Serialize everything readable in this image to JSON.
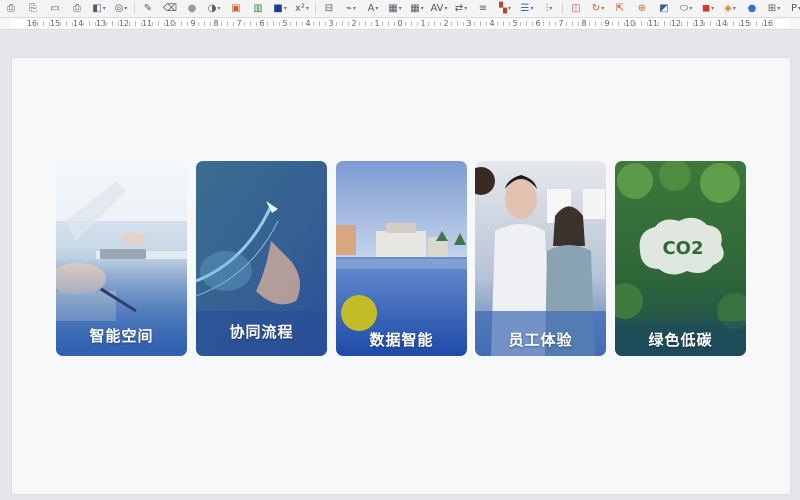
{
  "toolbar": {
    "icons": [
      "print-icon",
      "print-preview-icon",
      "page-setup-icon",
      "format-painter-icon",
      "text-color-icon",
      "clear-format-icon",
      "brush-icon",
      "eraser-icon",
      "circle-icon",
      "shape-icon",
      "image-icon",
      "chart-icon",
      "table-style-icon",
      "fill-color-icon",
      "superscript-icon",
      "textbox-icon",
      "link-icon",
      "font-icon",
      "border-icon",
      "table-icon",
      "spacing-icon",
      "text-direction-icon",
      "align-icon",
      "color-grid-icon",
      "indent-icon",
      "distribute-icon",
      "crop-icon",
      "rotate-icon",
      "arrange-icon",
      "group-icon",
      "shadow-icon",
      "outline-icon",
      "shape-fill-icon",
      "effects-icon",
      "record-icon",
      "export-icon",
      "picture-icon",
      "share-icon",
      "more-icon"
    ]
  },
  "ruler": {
    "labels": [
      "16",
      "15",
      "14",
      "13",
      "12",
      "11",
      "10",
      "9",
      "8",
      "7",
      "6",
      "5",
      "4",
      "3",
      "2",
      "1",
      "0",
      "1",
      "2",
      "3",
      "4",
      "5",
      "6",
      "7",
      "8",
      "9",
      "10",
      "11",
      "12",
      "13",
      "14",
      "15",
      "16"
    ]
  },
  "slide": {
    "cards": [
      {
        "label": "智能空间"
      },
      {
        "label": "协同流程"
      },
      {
        "label": "数据智能"
      },
      {
        "label": "员工体验"
      },
      {
        "label": "绿色低碳",
        "badge": "CO2"
      }
    ]
  },
  "colors": {
    "accent_yellow": "#c9c21f",
    "card_blue": "#2f64b8",
    "card_green": "#2f6a3c"
  }
}
